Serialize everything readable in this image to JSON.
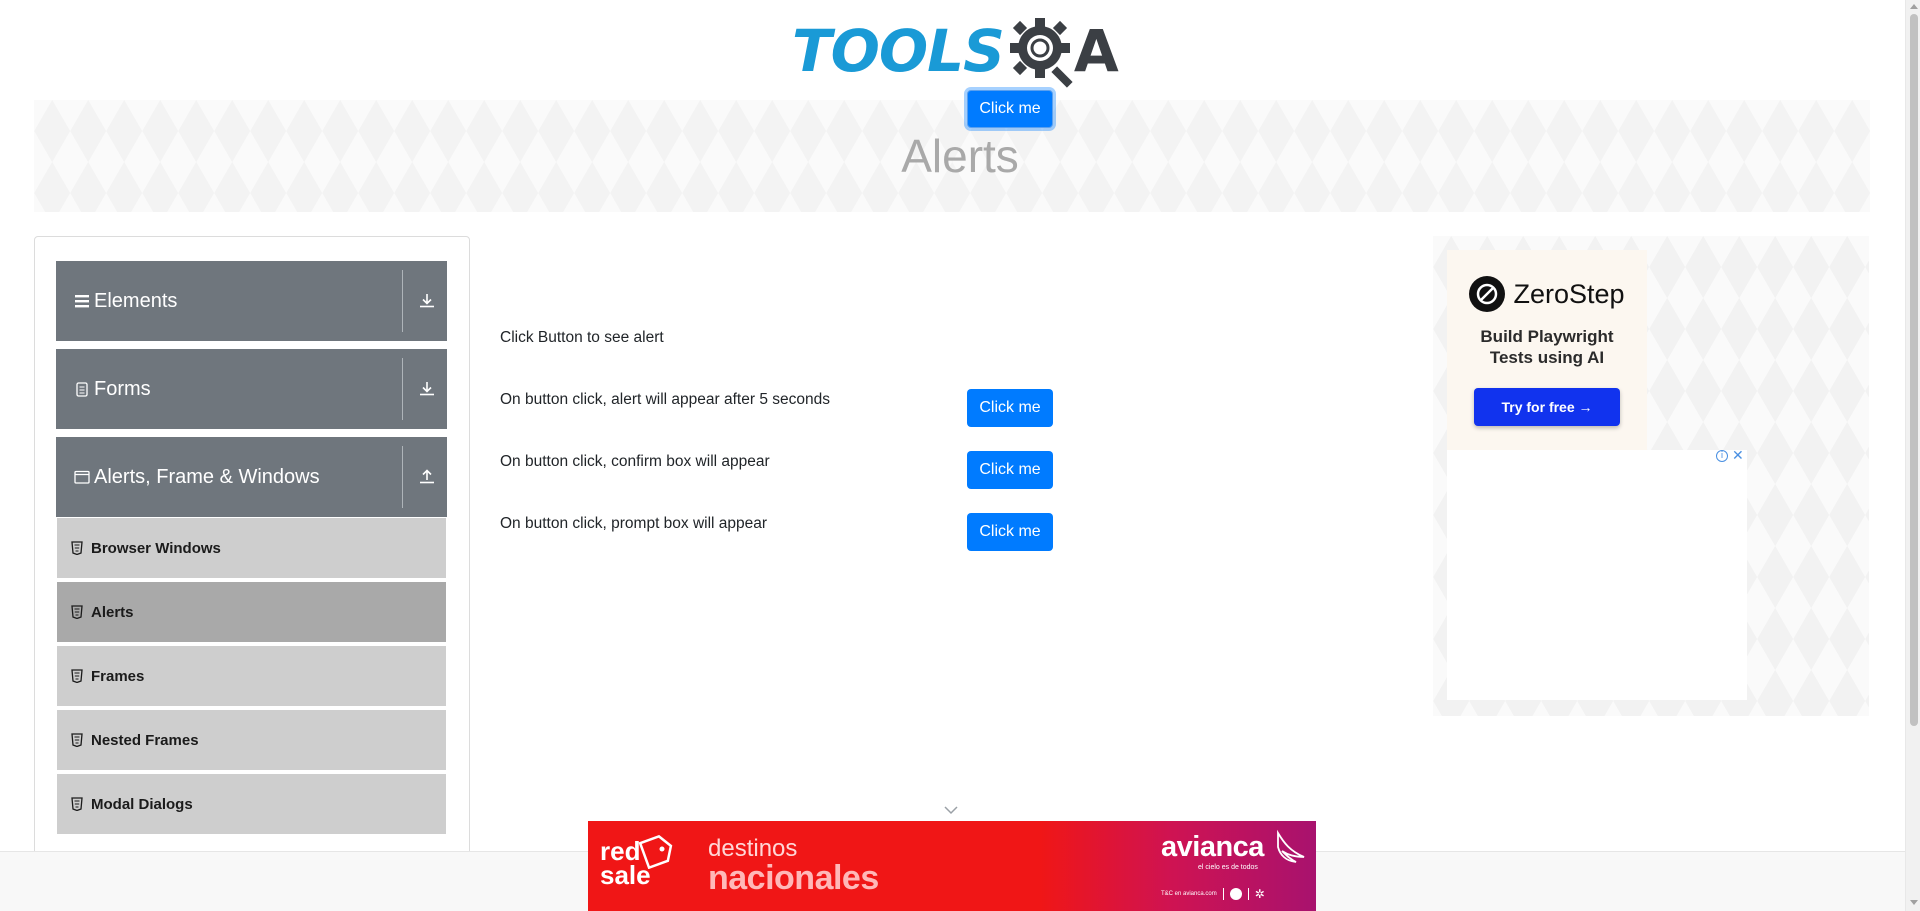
{
  "header": {
    "logo_text": "TOOLS",
    "logo_suffix": "A",
    "logo_colors": {
      "primary": "#1a9ad6",
      "secondary": "#3b3f44"
    }
  },
  "banner": {
    "title": "Alerts"
  },
  "sidebar": {
    "groups": [
      {
        "label": "Elements",
        "icon": "hamburger-icon",
        "toggle": "download-icon"
      },
      {
        "label": "Forms",
        "icon": "form-icon",
        "toggle": "download-icon"
      },
      {
        "label": "Alerts, Frame & Windows",
        "icon": "window-icon",
        "toggle": "upload-icon"
      }
    ],
    "items": [
      {
        "label": "Browser Windows",
        "active": false
      },
      {
        "label": "Alerts",
        "active": true
      },
      {
        "label": "Frames",
        "active": false
      },
      {
        "label": "Nested Frames",
        "active": false
      },
      {
        "label": "Modal Dialogs",
        "active": false
      }
    ],
    "colors": {
      "group_bg": "#6f767d",
      "item_bg": "#cecece",
      "item_active_bg": "#a9a9a9"
    }
  },
  "main": {
    "rows": [
      {
        "label": "Click Button to see alert",
        "button": "Click me"
      },
      {
        "label": "On button click, alert will appear after 5 seconds",
        "button": "Click me"
      },
      {
        "label": "On button click, confirm box will appear",
        "button": "Click me"
      },
      {
        "label": "On button click, prompt box will appear",
        "button": "Click me"
      }
    ],
    "button_color": "#007bff"
  },
  "ad_right": {
    "brand": "ZeroStep",
    "tagline_line1": "Build Playwright",
    "tagline_line2": "Tests using AI",
    "cta": "Try for free →",
    "cta_color": "#1133ee",
    "info_glyph": "i",
    "close_glyph": "✕"
  },
  "ad_bottom": {
    "mark_line1": "red",
    "mark_line2": "sale",
    "headline_line1": "destinos",
    "headline_line2": "nacionales",
    "brand": "avianca",
    "brand_tagline": "el cielo es de todos",
    "terms": "T&C en avianca.com",
    "bg_color": "#f01616"
  }
}
